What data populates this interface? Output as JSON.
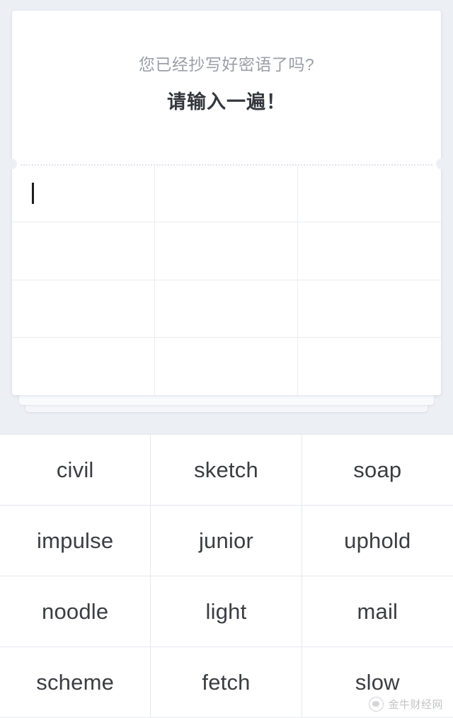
{
  "background_color": "#eceff4",
  "card": {
    "background_color": "#ffffff",
    "prompt_question": "您已经抄写好密语了吗?",
    "prompt_instruction": "请输入一遍！",
    "input_grid": {
      "columns": 3,
      "rows": 4,
      "cells": [
        [
          "",
          "",
          ""
        ],
        [
          "",
          "",
          ""
        ],
        [
          "",
          "",
          ""
        ],
        [
          "",
          "",
          ""
        ]
      ],
      "caret_cell": {
        "row": 0,
        "col": 0
      },
      "caret_color": "#1c1c1c",
      "line_color": "#e9ecf1"
    },
    "perforation": {
      "style": "dotted",
      "color": "#dfe3ec"
    }
  },
  "word_grid": {
    "columns": 3,
    "rows": 4,
    "text_color": "#3b3d42",
    "line_color": "#e6e8ed",
    "words": [
      [
        "civil",
        "sketch",
        "soap"
      ],
      [
        "impulse",
        "junior",
        "uphold"
      ],
      [
        "noodle",
        "light",
        "mail"
      ],
      [
        "scheme",
        "fetch",
        "slow"
      ]
    ]
  },
  "watermark": {
    "text": "金牛财经网",
    "icon": "bull-logo-icon"
  }
}
